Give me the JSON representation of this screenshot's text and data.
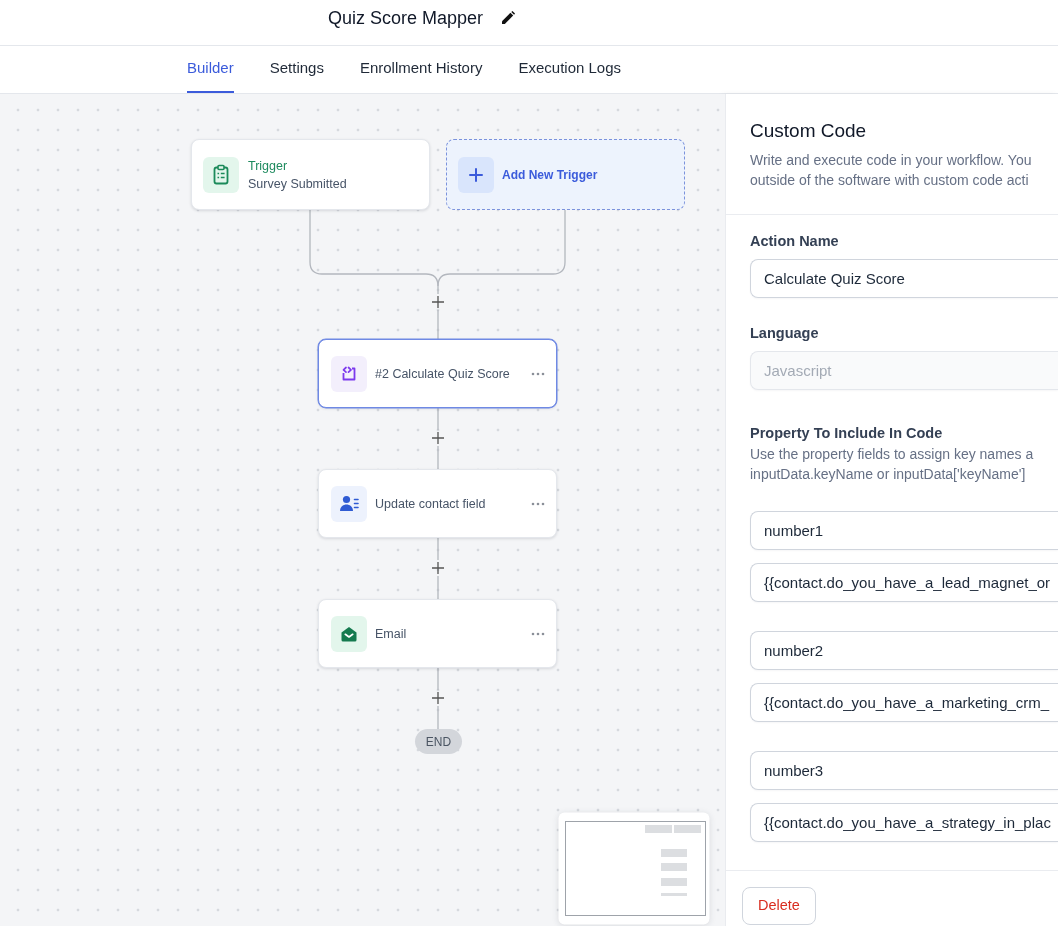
{
  "header": {
    "title": "Quiz Score Mapper"
  },
  "tabs": [
    {
      "label": "Builder",
      "selected": true
    },
    {
      "label": "Settings",
      "selected": false
    },
    {
      "label": "Enrollment History",
      "selected": false
    },
    {
      "label": "Execution Logs",
      "selected": false
    }
  ],
  "canvas": {
    "triggers": [
      {
        "kind": "trigger",
        "title": "Trigger",
        "subtitle": "Survey Submitted"
      },
      {
        "kind": "add_trigger",
        "label": "Add New Trigger"
      }
    ],
    "steps": [
      {
        "kind": "code",
        "label": "#2 Calculate Quiz Score",
        "selected": true
      },
      {
        "kind": "contact",
        "label": "Update contact field",
        "selected": false
      },
      {
        "kind": "email",
        "label": "Email",
        "selected": false
      }
    ],
    "end_label": "END"
  },
  "panel": {
    "title": "Custom Code",
    "description_lines": [
      "Write and execute code in your workflow. You",
      "outside of the software with custom code acti"
    ],
    "fields": [
      {
        "label": "Action Name",
        "value": "Calculate Quiz Score",
        "disabled": false
      },
      {
        "label": "Language",
        "value": "Javascript",
        "disabled": true
      }
    ],
    "properties": {
      "label": "Property To Include In Code",
      "help_lines": [
        "Use the property fields to assign key names a",
        "inputData.keyName or inputData['keyName']"
      ],
      "pairs": [
        {
          "key": "number1",
          "value": "{{contact.do_you_have_a_lead_magnet_or"
        },
        {
          "key": "number2",
          "value": "{{contact.do_you_have_a_marketing_crm_"
        },
        {
          "key": "number3",
          "value": "{{contact.do_you_have_a_strategy_in_plac"
        }
      ]
    },
    "delete_label": "Delete"
  }
}
